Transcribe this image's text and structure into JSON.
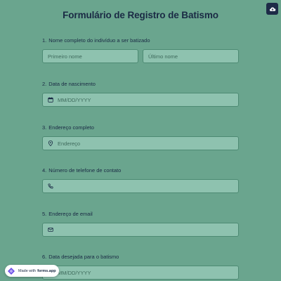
{
  "form": {
    "title": "Formulário de Registro de Batismo",
    "questions": [
      {
        "number": "1.",
        "label": "Nome completo do indivíduo a ser batizado",
        "fields": [
          {
            "placeholder": "Primeiro nome",
            "icon": ""
          },
          {
            "placeholder": "Último nome",
            "icon": ""
          }
        ]
      },
      {
        "number": "2.",
        "label": "Data de nascimento",
        "fields": [
          {
            "placeholder": "MM/DD/YYYY",
            "icon": "calendar-icon"
          }
        ]
      },
      {
        "number": "3.",
        "label": "Endereço completo",
        "fields": [
          {
            "placeholder": "Endereço",
            "icon": "location-pin-icon"
          }
        ]
      },
      {
        "number": "4.",
        "label": "Número de telefone de contato",
        "fields": [
          {
            "placeholder": "",
            "icon": "phone-icon"
          }
        ]
      },
      {
        "number": "5.",
        "label": "Endereço de email",
        "fields": [
          {
            "placeholder": "",
            "icon": "mail-icon"
          }
        ]
      },
      {
        "number": "6.",
        "label": "Data desejada para o batismo",
        "fields": [
          {
            "placeholder": "MM/DD/YYYY",
            "icon": "calendar-icon"
          }
        ]
      }
    ]
  },
  "badge": {
    "prefix": "Made with",
    "brand": "forms.app"
  },
  "top_button": {
    "icon": "cloud-upload-icon"
  },
  "colors": {
    "background": "#6aa58e",
    "field_background": "#8ec2af",
    "field_border": "#4d8a73",
    "text": "#1a2a44"
  }
}
